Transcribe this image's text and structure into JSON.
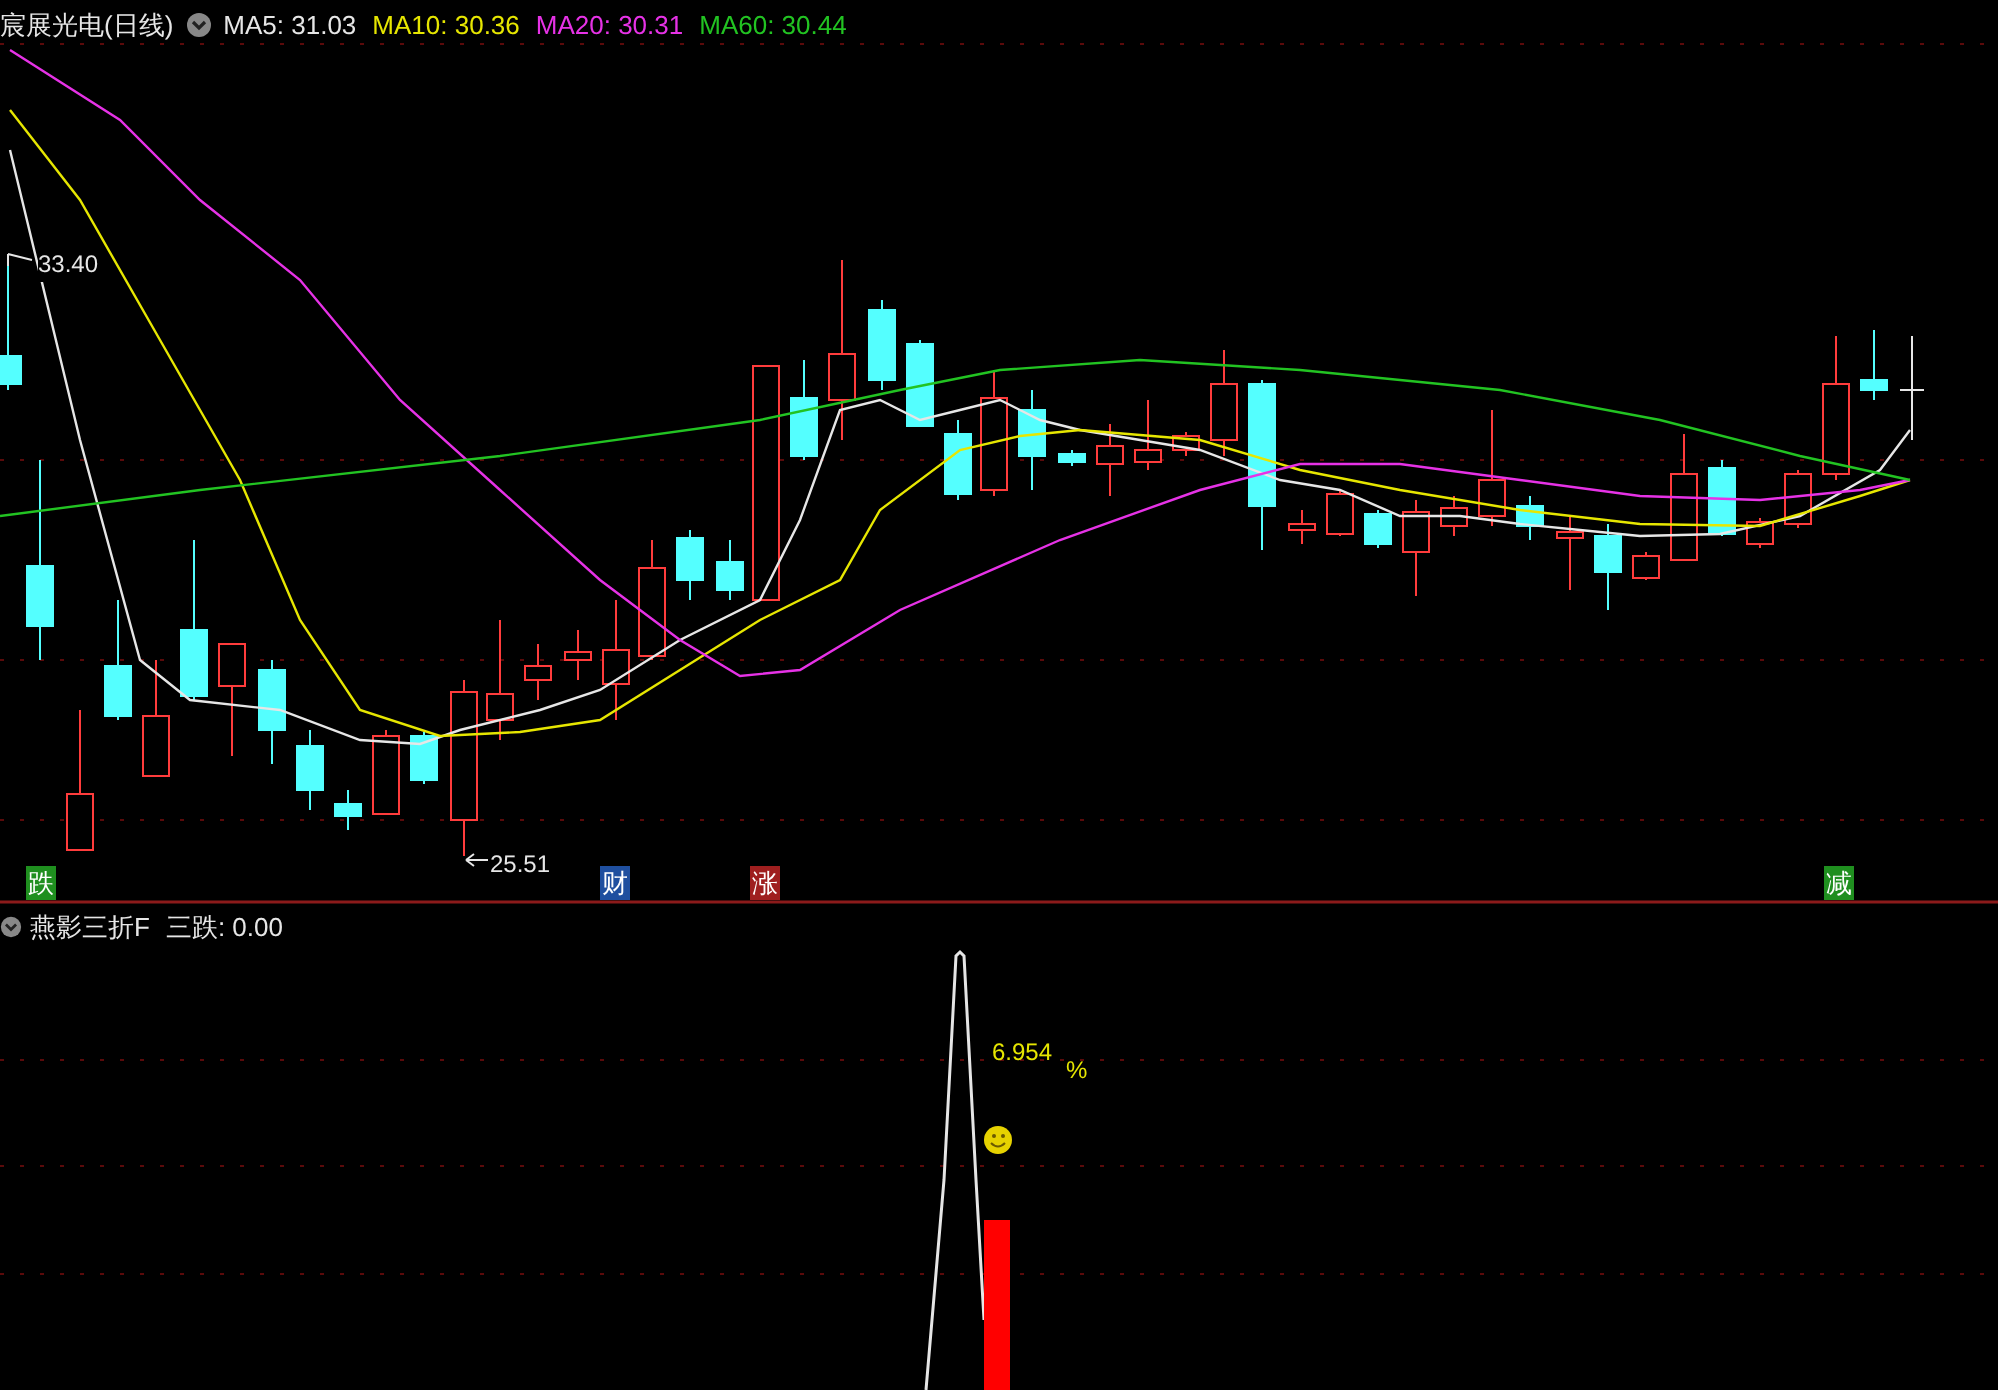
{
  "main_panel": {
    "title": "宸展光电(日线)",
    "moving_averages": [
      {
        "label": "MA5: 31.03",
        "color": "#e6e6e6"
      },
      {
        "label": "MA10: 30.36",
        "color": "#e6e600"
      },
      {
        "label": "MA20: 30.31",
        "color": "#e632e6"
      },
      {
        "label": "MA60: 30.44",
        "color": "#22c322"
      }
    ],
    "price_labels": [
      "33.40",
      "25.51"
    ],
    "signals": [
      {
        "label": "跌",
        "color": "#1f8f1f"
      },
      {
        "label": "财",
        "color": "#1f4f9f"
      },
      {
        "label": "涨",
        "color": "#9f1f1f"
      },
      {
        "label": "减",
        "color": "#1f8f1f"
      }
    ]
  },
  "indicator_panel": {
    "name": "燕影三折F",
    "reading": "三跌: 0.00",
    "value_label": "6.954",
    "unit": "%"
  }
}
